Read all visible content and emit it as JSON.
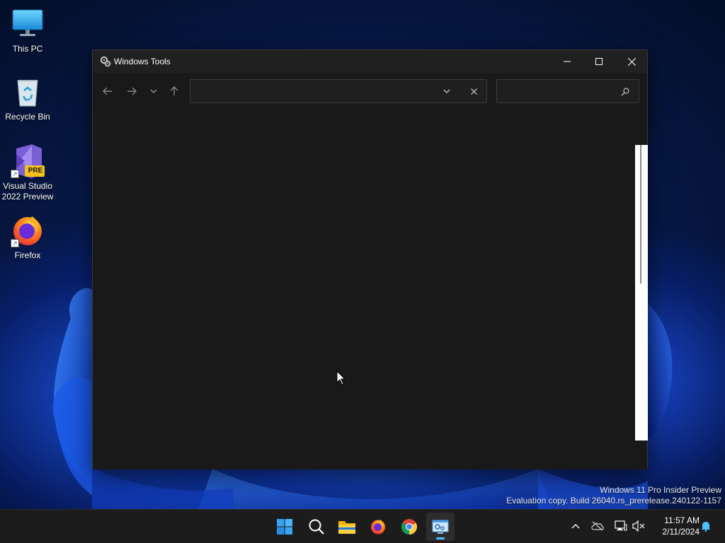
{
  "desktop": {
    "icons": [
      {
        "label": "This PC",
        "icon": "monitor-icon"
      },
      {
        "label": "Recycle Bin",
        "icon": "recycle-bin-icon"
      },
      {
        "label": "Visual Studio\n2022 Preview",
        "icon": "visual-studio-icon",
        "badge": "PRE"
      },
      {
        "label": "Firefox",
        "icon": "firefox-icon"
      }
    ]
  },
  "window": {
    "title": "Windows Tools",
    "address": {
      "value": "",
      "placeholder": ""
    },
    "search": {
      "value": "",
      "placeholder": ""
    }
  },
  "watermark": {
    "line1": "Windows 11 Pro Insider Preview",
    "line2": "Evaluation copy. Build 26040.rs_prerelease.240122-1157"
  },
  "taskbar": {
    "apps": [
      "start-icon",
      "search-icon",
      "file-explorer-icon",
      "firefox-icon",
      "chrome-icon",
      "windows-tools-icon"
    ],
    "active_app": "Windows Tools"
  },
  "tray": {
    "time": "11:57 AM",
    "date": "2/11/2024"
  },
  "colors": {
    "accent": "#4cc2ff",
    "window_bg": "#191919",
    "titlebar_bg": "#202020",
    "taskbar_bg": "#1c1c1c"
  }
}
